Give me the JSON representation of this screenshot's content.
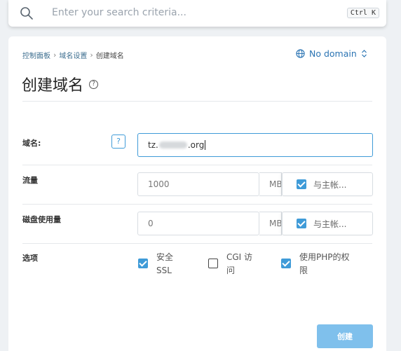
{
  "search": {
    "placeholder": "Enter your search criteria...",
    "shortcut": "Ctrl K"
  },
  "breadcrumb": {
    "items": [
      "控制面板",
      "域名设置",
      "创建域名"
    ],
    "separator": "›"
  },
  "domain_selector": {
    "label": "No domain"
  },
  "page": {
    "title": "创建域名"
  },
  "form": {
    "domain": {
      "label": "域名:",
      "help": "?",
      "value_prefix": "tz.",
      "value_suffix": ".org"
    },
    "bandwidth": {
      "label": "流量",
      "value": "1000",
      "unit": "MB",
      "same_as_main": "与主帐..."
    },
    "disk": {
      "label": "磁盘使用量",
      "value": "0",
      "unit": "MB",
      "same_as_main": "与主帐..."
    },
    "options": {
      "label": "选项",
      "items": [
        {
          "line1": "安全",
          "line2": "SSL",
          "checked": true
        },
        {
          "line1": "CGI 访",
          "line2": "问",
          "checked": false
        },
        {
          "line1": "使用PHP的权",
          "line2": "限",
          "checked": true
        }
      ]
    }
  },
  "actions": {
    "create": "创建"
  },
  "colors": {
    "accent": "#3f9bd8",
    "button_disabled": "#7fc0ec",
    "link": "#2b74b3"
  }
}
